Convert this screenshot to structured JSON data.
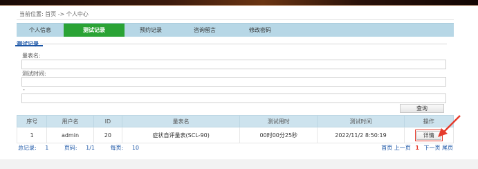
{
  "breadcrumb": {
    "text": "当前位置: 首页 -> 个人中心"
  },
  "tabs": [
    {
      "label": "个人信息"
    },
    {
      "label": "测试记录"
    },
    {
      "label": "预约记录"
    },
    {
      "label": "咨询留言"
    },
    {
      "label": "修改密码"
    }
  ],
  "search": {
    "legend": "测试记录",
    "scale_label": "量表名:",
    "time_label": "测试时间:",
    "range_sep": "-",
    "query_button": "查询"
  },
  "table": {
    "headers": [
      "序号",
      "用户名",
      "ID",
      "量表名",
      "测试用时",
      "测试时间",
      "操作"
    ],
    "rows": [
      {
        "no": "1",
        "user": "admin",
        "id": "20",
        "scale": "症状自评量表(SCL-90)",
        "duration": "00时00分25秒",
        "time": "2022/11/2 8:50:19",
        "action": "详情"
      }
    ]
  },
  "pager": {
    "total_label": "总记录:",
    "total": "1",
    "page_label": "页码:",
    "page": "1/1",
    "per_label": "每页:",
    "per": "10",
    "first": "首页",
    "prev": "上一页",
    "current": "1",
    "next": "下一页",
    "last": "尾页"
  },
  "colors": {
    "tab_active": "#2aa335",
    "tab_bar": "#b7d7e6",
    "link": "#1a55a6",
    "highlight": "#e53b2c"
  }
}
